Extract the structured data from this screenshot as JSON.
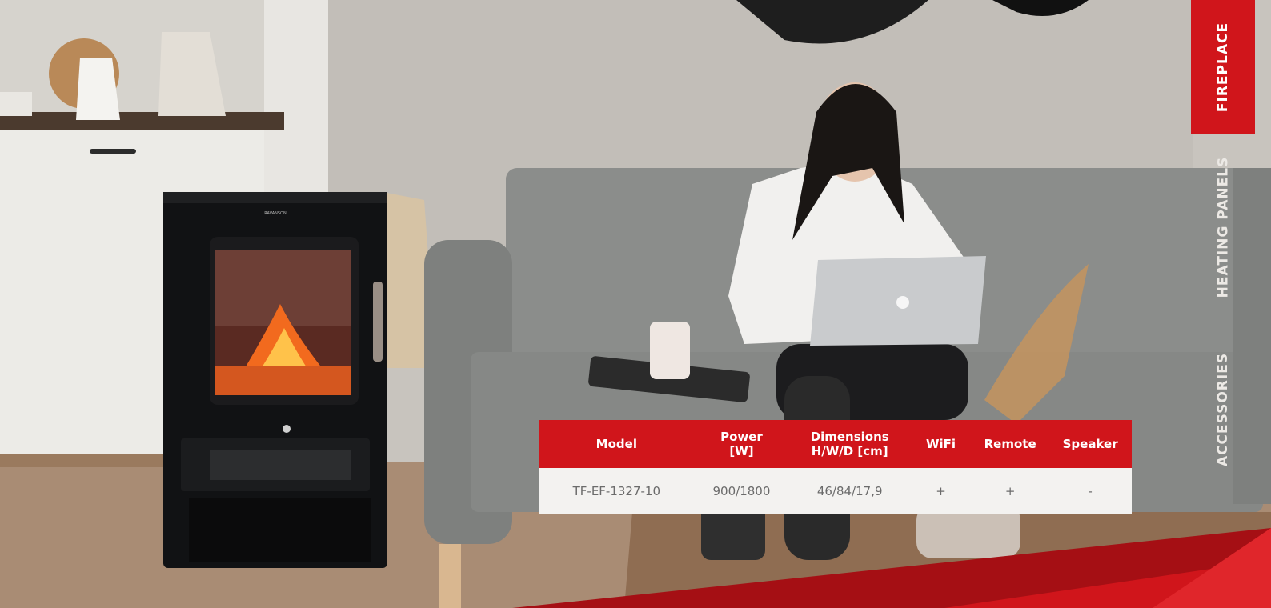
{
  "side_nav": {
    "items": [
      {
        "label": "FIREPLACE",
        "active": true
      },
      {
        "label": "HEATING PANELS",
        "active": false
      },
      {
        "label": "ACCESSORIES",
        "active": false
      }
    ]
  },
  "product": {
    "brand_mark": "RAVANSON"
  },
  "spec_table": {
    "headers": [
      {
        "line1": "Model",
        "line2": ""
      },
      {
        "line1": "Power",
        "line2": "[W]"
      },
      {
        "line1": "Dimensions",
        "line2": "H/W/D [cm]"
      },
      {
        "line1": "WiFi",
        "line2": ""
      },
      {
        "line1": "Remote",
        "line2": ""
      },
      {
        "line1": "Speaker",
        "line2": ""
      }
    ],
    "rows": [
      [
        "TF-EF-1327-10",
        "900/1800",
        "46/84/17,9",
        "+",
        "+",
        "-"
      ]
    ]
  },
  "colors": {
    "accent_red": "#d0151b",
    "table_row_bg": "#f3f2f0"
  }
}
